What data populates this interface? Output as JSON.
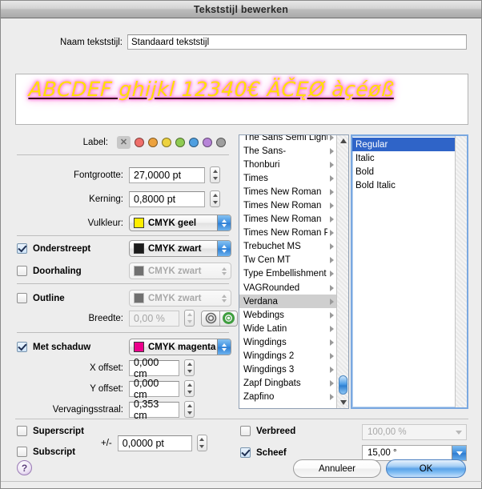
{
  "window": {
    "title": "Tekststijl bewerken"
  },
  "name_field": {
    "label": "Naam tekststijl:",
    "value": "Standaard tekststijl",
    "placeholder": ""
  },
  "preview": {
    "sample_text": "ABCDEF ghijkl 12340€ ÄČĘØ àçéøß",
    "fill_color": "#ffe000",
    "shadow_color": "#ff5ad0",
    "underline_color": "#3a0020"
  },
  "label_row": {
    "caption": "Label:",
    "none_glyph": "✕",
    "colors": [
      "#ef6f6a",
      "#eda23e",
      "#edd23e",
      "#8fcb52",
      "#4f9fe0",
      "#b784d8",
      "#9e9e9e"
    ]
  },
  "fields": {
    "fontsize": {
      "label": "Fontgrootte:",
      "value": "27,0000 pt"
    },
    "kerning": {
      "label": "Kerning:",
      "value": "0,8000 pt"
    },
    "fillcolor": {
      "label": "Vulkleur:",
      "value": "CMYK geel",
      "swatch": "#ffee00"
    },
    "underline": {
      "label": "Onderstreept",
      "checked": true,
      "color_value": "CMYK zwart",
      "swatch": "#1c1c1c"
    },
    "strikethrough": {
      "label": "Doorhaling",
      "checked": false,
      "color_value": "CMYK zwart",
      "swatch": "#707070"
    },
    "outline": {
      "label": "Outline",
      "checked": false,
      "color_value": "CMYK zwart",
      "swatch": "#707070"
    },
    "width": {
      "label": "Breedte:",
      "value": "0,00 %"
    },
    "shadow": {
      "label": "Met schaduw",
      "checked": true,
      "color_value": "CMYK magenta",
      "swatch": "#ec008c"
    },
    "xoffset": {
      "label": "X offset:",
      "value": "0,000 cm"
    },
    "yoffset": {
      "label": "Y offset:",
      "value": "0,000 cm"
    },
    "blurradius": {
      "label": "Vervagingsstraal:",
      "value": "0,353 cm"
    }
  },
  "bottom": {
    "superscript": {
      "label": "Superscript",
      "checked": false
    },
    "subscript": {
      "label": "Subscript",
      "checked": false
    },
    "plusminus_label": "+/-",
    "plusminus_value": "0,0000 pt",
    "verbreed": {
      "label": "Verbreed",
      "checked": false,
      "value": "100,00 %"
    },
    "scheef": {
      "label": "Scheef",
      "checked": true,
      "value": "15,00 °"
    }
  },
  "font_list": {
    "selected": "Verdana",
    "items": [
      "The Sans Semi Light",
      "The Sans-",
      "Thonburi",
      "Times",
      "Times New Roman",
      "Times New Roman",
      "Times New Roman",
      "Times New Roman P",
      "Trebuchet MS",
      "Tw Cen MT",
      "Type Embellishment",
      "VAGRounded",
      "Verdana",
      "Webdings",
      "Wide Latin",
      "Wingdings",
      "Wingdings 2",
      "Wingdings 3",
      "Zapf Dingbats",
      "Zapfino"
    ]
  },
  "style_list": {
    "selected": "Regular",
    "items": [
      "Regular",
      "Italic",
      "Bold",
      "Bold Italic"
    ]
  },
  "footer": {
    "help": "?",
    "cancel": "Annuleer",
    "ok": "OK"
  }
}
